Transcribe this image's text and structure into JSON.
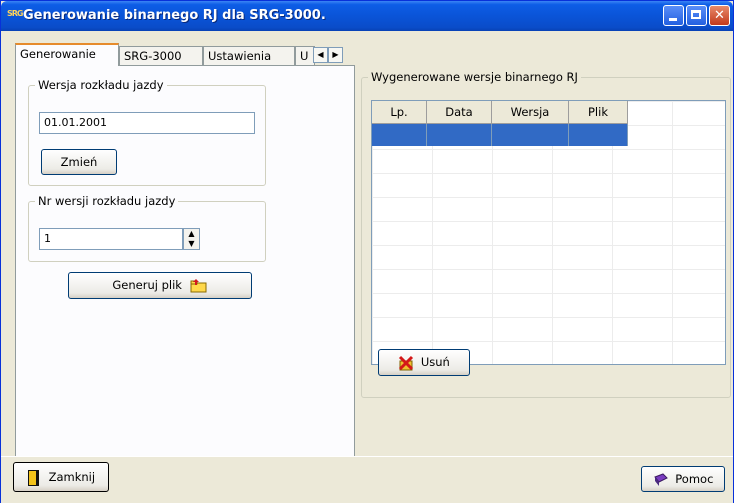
{
  "window": {
    "title": "Generowanie binarnego RJ dla SRG-3000.",
    "icon_text": "SRG"
  },
  "tabs": [
    {
      "label": "Generowanie",
      "active": true
    },
    {
      "label": "SRG-3000",
      "active": false
    },
    {
      "label": "Ustawienia",
      "active": false
    },
    {
      "label": "U",
      "active": false
    }
  ],
  "tab_scroll": {
    "left": "◀",
    "right": "▶"
  },
  "generate_tab": {
    "schedule_version_group": {
      "legend": "Wersja rozkładu jazdy",
      "value": "01.01.2001",
      "change_button": "Zmień"
    },
    "schedule_number_group": {
      "legend": "Nr wersji rozkładu jazdy",
      "value": "1"
    },
    "generate_button": "Generuj plik"
  },
  "generated_versions": {
    "legend": "Wygenerowane wersje binarnego RJ",
    "columns": [
      "Lp.",
      "Data",
      "Wersja",
      "Plik"
    ],
    "rows": [
      [
        "",
        "",
        "",
        ""
      ]
    ],
    "delete_button": "Usuń"
  },
  "footer": {
    "close_button": "Zamknij",
    "help_button": "Pomoc"
  },
  "colors": {
    "titlebar": "#0a54d8",
    "selection": "#316ac5",
    "active_tab_accent": "#e68b2c"
  }
}
